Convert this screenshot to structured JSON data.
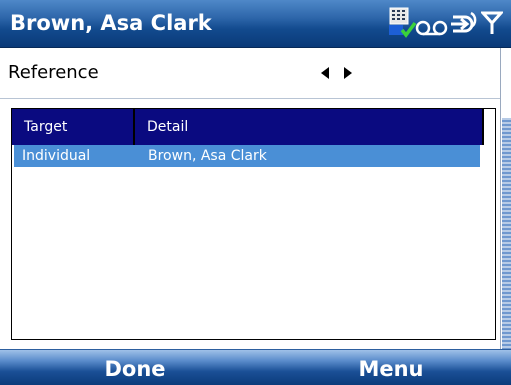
{
  "window": {
    "title": "Brown, Asa Clark"
  },
  "status_icons": [
    "signal-grid-icon",
    "voicemail-icon",
    "connectivity-icon",
    "antenna-signal-icon"
  ],
  "reference": {
    "label": "Reference",
    "prev_icon": "arrow-left-icon",
    "next_icon": "arrow-right-icon"
  },
  "list": {
    "columns": [
      "Target",
      "Detail"
    ],
    "rows": [
      {
        "target": "Individual",
        "detail": "Brown, Asa Clark",
        "selected": true
      }
    ]
  },
  "softkeys": {
    "left": "Done",
    "right": "Menu"
  },
  "colors": {
    "title_bar": "#124a8e",
    "header_bg": "#0a0a80",
    "selection": "#4a8fd6",
    "softkey_bar": "#1a4f96"
  }
}
